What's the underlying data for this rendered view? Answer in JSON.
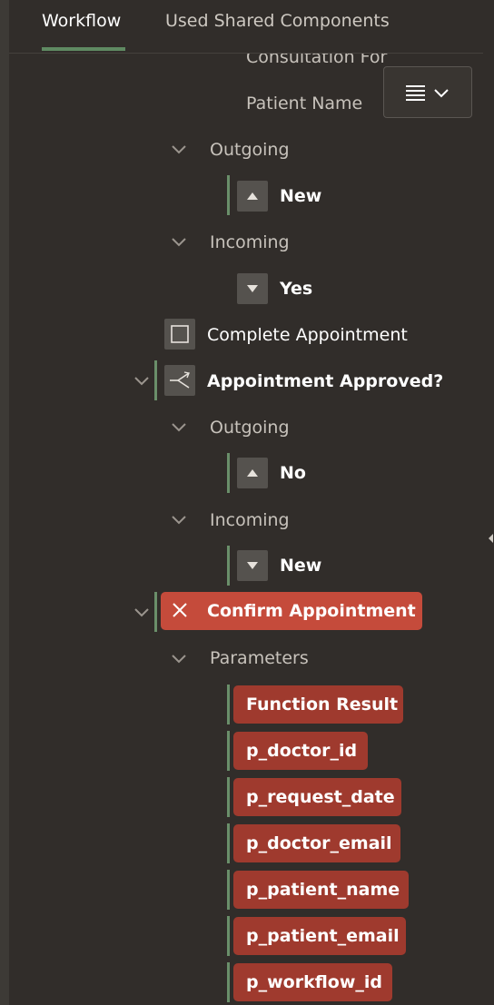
{
  "tabs": {
    "workflow": "Workflow",
    "shared": "Used Shared Components"
  },
  "tree": {
    "consultation_label": "Consultation For",
    "patient_name_label": "Patient Name",
    "outgoing1_label": "Outgoing",
    "new1_label": "New",
    "incoming1_label": "Incoming",
    "yes_label": "Yes",
    "complete_label": "Complete Appointment",
    "approved_label": "Appointment Approved?",
    "outgoing2_label": "Outgoing",
    "no_label": "No",
    "incoming2_label": "Incoming",
    "new2_label": "New",
    "confirm_label": "Confirm Appointment",
    "parameters_label": "Parameters",
    "params": [
      "Function Result",
      "p_doctor_id",
      "p_request_date",
      "p_doctor_email",
      "p_patient_name",
      "p_patient_email",
      "p_workflow_id"
    ]
  },
  "icons": {
    "menu": "menu-icon",
    "chevron": "chevron-down-icon",
    "up": "arrow-up-icon",
    "down": "arrow-down-icon",
    "activity": "square-icon",
    "switch": "switch-icon",
    "error": "x-icon"
  },
  "colors": {
    "background": "#312d2a",
    "accent": "#6a8f6a",
    "error_pill": "#9f3a2e",
    "error_selected": "#c54b3b"
  }
}
